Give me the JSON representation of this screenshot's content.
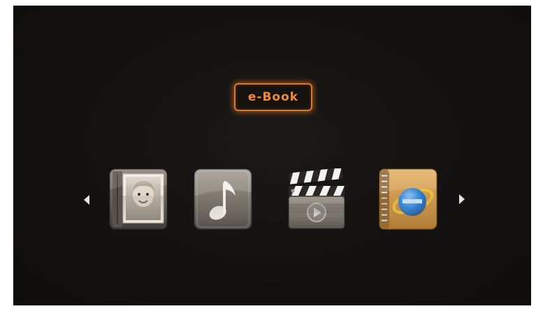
{
  "menu": {
    "selected_title": "e-Book",
    "accent_color": "#e0782a",
    "apps": [
      {
        "icon": "photo-album-icon"
      },
      {
        "icon": "music-note-icon"
      },
      {
        "icon": "movie-clapperboard-icon"
      },
      {
        "icon": "ebook-notebook-icon"
      }
    ],
    "nav": {
      "left_icon": "arrow-left-icon",
      "right_icon": "arrow-right-icon"
    }
  }
}
